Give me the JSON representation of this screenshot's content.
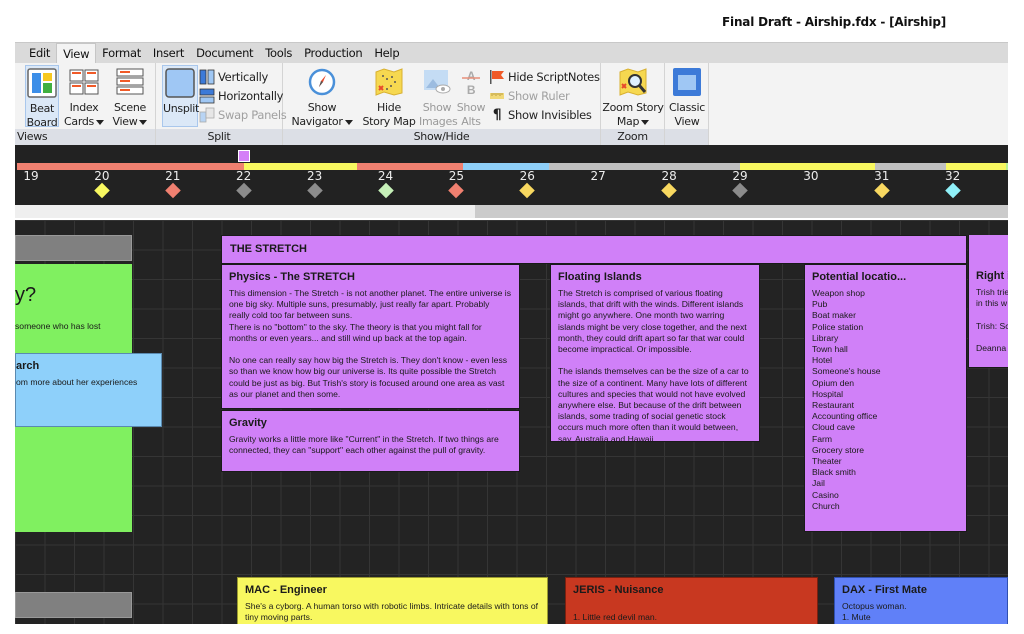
{
  "window": {
    "title": "Final Draft - Airship.fdx - [Airship]"
  },
  "menu": {
    "items": [
      {
        "label": "Edit",
        "active": false
      },
      {
        "label": "View",
        "active": true
      },
      {
        "label": "Format",
        "active": false
      },
      {
        "label": "Insert",
        "active": false
      },
      {
        "label": "Document",
        "active": false
      },
      {
        "label": "Tools",
        "active": false
      },
      {
        "label": "Production",
        "active": false
      },
      {
        "label": "Help",
        "active": false
      }
    ]
  },
  "ribbon": {
    "views": {
      "label": "Views",
      "beat_board": {
        "line1": "Beat",
        "line2": "Board",
        "icon": "beat-board-icon"
      },
      "index_cards": {
        "line1": "Index",
        "line2": "Cards",
        "icon": "index-cards-icon"
      },
      "scene_view": {
        "line1": "Scene",
        "line2": "View",
        "icon": "scene-view-icon"
      }
    },
    "split": {
      "label": "Split",
      "unsplit": {
        "label": "Unsplit",
        "icon": "unsplit-icon"
      },
      "vertically": "Vertically",
      "horizontally": "Horizontally",
      "swap_panels": "Swap Panels"
    },
    "show_hide": {
      "label": "Show/Hide",
      "show_navigator": {
        "line1": "Show",
        "line2": "Navigator",
        "icon": "compass-icon"
      },
      "hide_story_map": {
        "line1": "Hide",
        "line2": "Story Map",
        "icon": "map-icon"
      },
      "show_images": {
        "line1": "Show",
        "line2": "Images",
        "icon": "image-icon"
      },
      "show_alts": {
        "line1": "Show",
        "line2": "Alts",
        "icon": "alts-icon"
      },
      "hide_scriptnotes": "Hide ScriptNotes",
      "show_ruler": "Show Ruler",
      "show_invisibles": "Show Invisibles"
    },
    "zoom": {
      "label": "Zoom",
      "zoom_story_map": {
        "line1": "Zoom Story",
        "line2": "Map",
        "icon": "zoom-map-icon"
      }
    },
    "classic": {
      "classic_view": {
        "line1": "Classic",
        "line2": "View",
        "icon": "classic-view-icon"
      }
    }
  },
  "story_map": {
    "pages": [
      "19",
      "20",
      "21",
      "22",
      "23",
      "24",
      "25",
      "26",
      "27",
      "28",
      "29",
      "30",
      "31",
      "32"
    ],
    "segments": [
      {
        "color": "#f08070",
        "from_page": 18.8,
        "to_page": 22.0
      },
      {
        "color": "#f8f860",
        "from_page": 22.0,
        "to_page": 23.6
      },
      {
        "color": "#f08070",
        "from_page": 23.6,
        "to_page": 25.1
      },
      {
        "color": "#8ecff8",
        "from_page": 25.1,
        "to_page": 26.3
      },
      {
        "color": "#c0c0c0",
        "from_page": 26.3,
        "to_page": 29.0
      },
      {
        "color": "#f8f860",
        "from_page": 29.0,
        "to_page": 30.9
      },
      {
        "color": "#c0c0c0",
        "from_page": 30.9,
        "to_page": 31.9
      },
      {
        "color": "#f8f860",
        "from_page": 31.9,
        "to_page": 32.75
      },
      {
        "color": "#b8f090",
        "from_page": 32.75,
        "to_page": 32.9
      }
    ],
    "diamonds": [
      {
        "page": 20,
        "color": "#f8f860"
      },
      {
        "page": 21,
        "color": "#f08070"
      },
      {
        "page": 22,
        "color": "#8c8c8c"
      },
      {
        "page": 23,
        "color": "#8c8c8c"
      },
      {
        "page": 24,
        "color": "#c6f0b8"
      },
      {
        "page": 25,
        "color": "#f08070"
      },
      {
        "page": 26,
        "color": "#f8d860"
      },
      {
        "page": 28,
        "color": "#f8d860"
      },
      {
        "page": 29,
        "color": "#8c8c8c"
      },
      {
        "page": 31,
        "color": "#f8d860"
      },
      {
        "page": 32,
        "color": "#90f0f8"
      }
    ],
    "current_marker_page": 22
  },
  "beat_board": {
    "beats": [
      {
        "title": "THE STRETCH",
        "color": "#d080f8"
      }
    ],
    "cards": [
      {
        "id": "left-green",
        "title": "",
        "headline": "y?",
        "body": "someone who has lost",
        "color": "#80f060"
      },
      {
        "id": "left-research",
        "title": "arch",
        "body": "om more about her experiences",
        "color": "#8ed0fa"
      },
      {
        "id": "physics",
        "title": "Physics - The STRETCH",
        "body": "This dimension - The Stretch - is not another planet. The entire universe is one big sky. Multiple suns, presumably, just really far apart. Probably really cold too far between suns.\nThere is no \"bottom\" to the sky. The theory is that you might fall for months or even years... and still wind up back at the top again.\n\nNo one can really say how big the Stretch is. They don't know - even less so than we know how big our universe is. Its quite possible the Stretch could be just as big. But Trish's story is focused around one area as vast as our planet and then some.",
        "color": "#d080f8"
      },
      {
        "id": "gravity",
        "title": "Gravity",
        "body": "Gravity works a little more like \"Current\" in the Stretch. If two things are connected, they can \"support\" each other against the pull of gravity.",
        "color": "#d080f8"
      },
      {
        "id": "floating",
        "title": "Floating Islands",
        "body": "The Stretch is comprised of various floating islands, that drift with the winds. Different islands might go anywhere. One month two warring islands might be very close together, and the next month, they could drift apart so far that war could become impractical. Or impossible.\n\nThe islands themselves can be the size of a car to the size of a continent. Many have lots of different cultures and species that would not have evolved anywhere else. But because of the drift between islands, some trading of social genetic stock occurs much more often than it would between, say, Australia and Hawaii.",
        "color": "#d080f8"
      },
      {
        "id": "locations",
        "title": "Potential locatio...",
        "body": "Weapon shop\nPub\nBoat maker\nPolice station\nLibrary\nTown hall\nHotel\nSomeone's house\nOpium den\nHospital\nRestaurant\nAccounting office\nCloud cave\nFarm\nGrocery store\nTheater\nBlack smith\nJail\nCasino\nChurch",
        "color": "#d080f8"
      },
      {
        "id": "right",
        "title": "Right is",
        "body": "Trish trie\nin this w\n\nTrish: Sc\n\nDeanna",
        "color": "#d080f8"
      },
      {
        "id": "mac",
        "title": "MAC - Engineer",
        "body": "She's a cyborg. A human torso with robotic limbs. Intricate details with tons of tiny moving parts.",
        "color": "#f8f860"
      },
      {
        "id": "jeris",
        "title": "JERIS - Nuisance",
        "body": "\n1. Little red devil man.",
        "color": "#c83820"
      },
      {
        "id": "dax",
        "title": "DAX - First Mate",
        "body": "Octopus woman.\n1. Mute",
        "color": "#6080f8"
      }
    ]
  }
}
